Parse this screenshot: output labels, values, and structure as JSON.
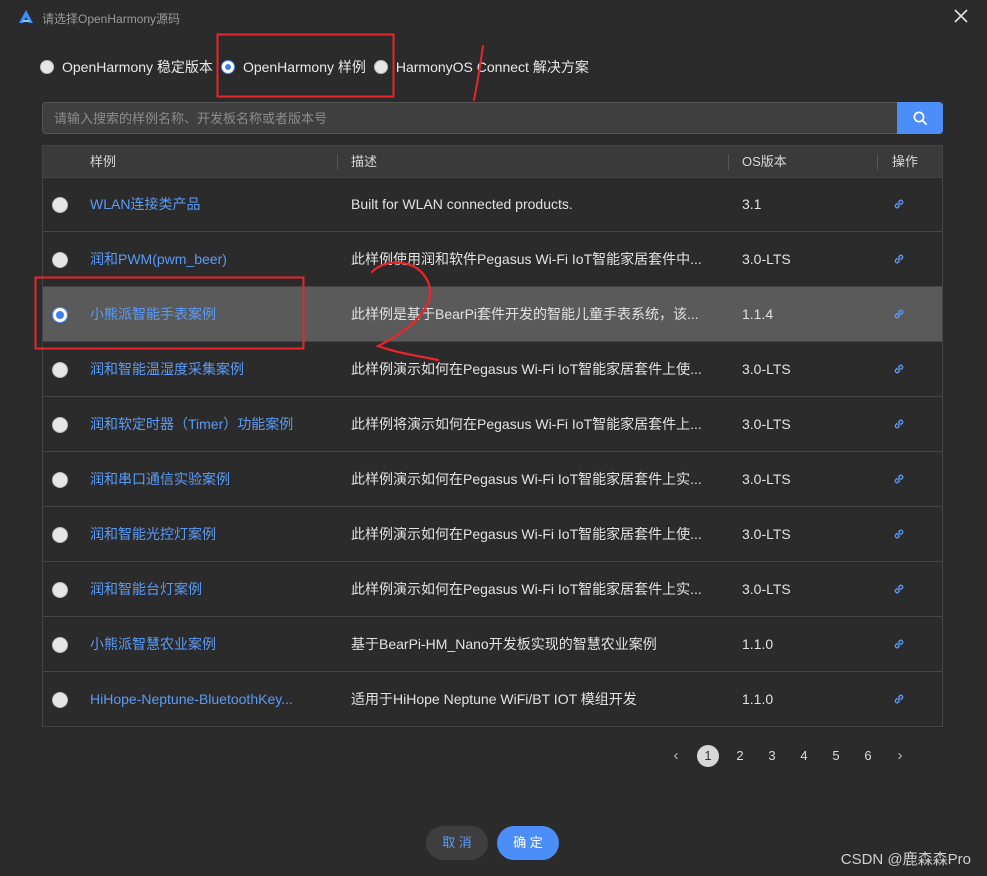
{
  "window": {
    "title": "请选择OpenHarmony源码"
  },
  "source_options": [
    {
      "label": "OpenHarmony 稳定版本",
      "selected": false
    },
    {
      "label": "OpenHarmony 样例",
      "selected": true
    },
    {
      "label": "HarmonyOS Connect 解决方案",
      "selected": false
    }
  ],
  "search": {
    "placeholder": "请输入搜索的样例名称、开发板名称或者版本号",
    "value": ""
  },
  "table": {
    "headers": {
      "name": "样例",
      "desc": "描述",
      "os": "OS版本",
      "op": "操作"
    },
    "rows": [
      {
        "name": "WLAN连接类产品",
        "desc": "Built for WLAN connected products.",
        "os": "3.1",
        "selected": false
      },
      {
        "name": "润和PWM(pwm_beer)",
        "desc": "此样例使用润和软件Pegasus Wi-Fi IoT智能家居套件中...",
        "os": "3.0-LTS",
        "selected": false
      },
      {
        "name": "小熊派智能手表案例",
        "desc": "此样例是基于BearPi套件开发的智能儿童手表系统，该...",
        "os": "1.1.4",
        "selected": true
      },
      {
        "name": "润和智能温湿度采集案例",
        "desc": "此样例演示如何在Pegasus Wi-Fi IoT智能家居套件上使...",
        "os": "3.0-LTS",
        "selected": false
      },
      {
        "name": "润和软定时器（Timer）功能案例",
        "desc": "此样例将演示如何在Pegasus Wi-Fi IoT智能家居套件上...",
        "os": "3.0-LTS",
        "selected": false
      },
      {
        "name": "润和串口通信实验案例",
        "desc": "此样例演示如何在Pegasus Wi-Fi IoT智能家居套件上实...",
        "os": "3.0-LTS",
        "selected": false
      },
      {
        "name": "润和智能光控灯案例",
        "desc": "此样例演示如何在Pegasus Wi-Fi IoT智能家居套件上使...",
        "os": "3.0-LTS",
        "selected": false
      },
      {
        "name": "润和智能台灯案例",
        "desc": "此样例演示如何在Pegasus Wi-Fi IoT智能家居套件上实...",
        "os": "3.0-LTS",
        "selected": false
      },
      {
        "name": "小熊派智慧农业案例",
        "desc": "基于BearPi-HM_Nano开发板实现的智慧农业案例",
        "os": "1.1.0",
        "selected": false
      },
      {
        "name": "HiHope-Neptune-BluetoothKey...",
        "desc": "适用于HiHope Neptune WiFi/BT IOT 模组开发",
        "os": "1.1.0",
        "selected": false
      }
    ]
  },
  "pagination": {
    "prev": "‹",
    "next": "›",
    "pages": [
      "1",
      "2",
      "3",
      "4",
      "5",
      "6"
    ],
    "current": "1"
  },
  "footer": {
    "cancel_label": "取 消",
    "ok_label": "确 定",
    "watermark": "CSDN @鹿森森Pro"
  },
  "colors": {
    "accent": "#4b8ef7",
    "link": "#5b9bf5",
    "annotation": "#e8262b",
    "selected_row": "#5a5a5a"
  },
  "icons": {
    "app": "harmony-a-icon",
    "close": "close-icon",
    "search": "search-icon",
    "op": "link-icon"
  }
}
